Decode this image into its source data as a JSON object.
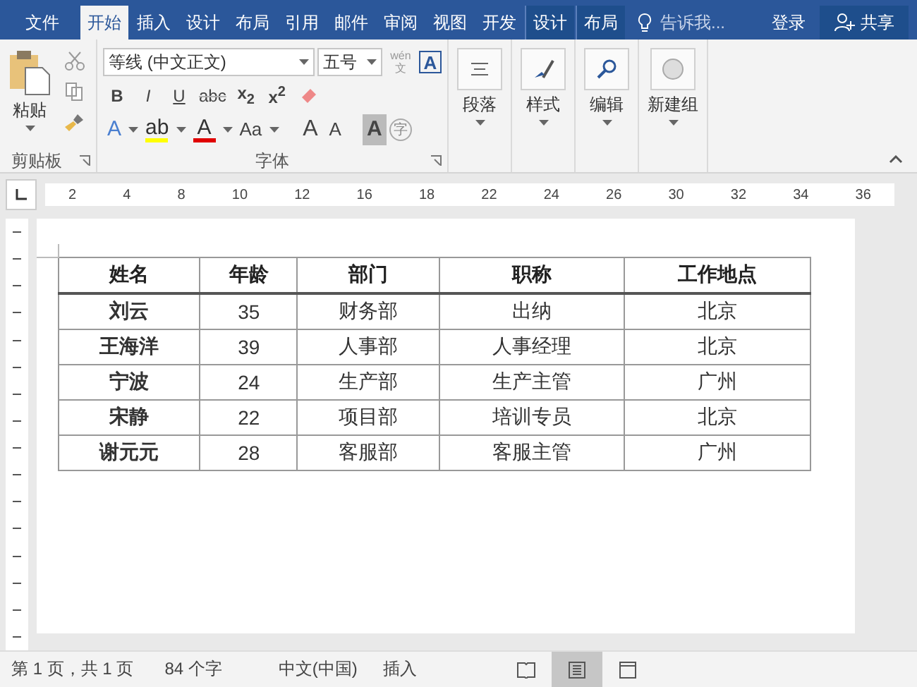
{
  "tabs": [
    {
      "label": "文件",
      "selected": false,
      "kind": "file"
    },
    {
      "label": "开始",
      "selected": true,
      "kind": "normal"
    },
    {
      "label": "插入",
      "selected": false,
      "kind": "normal"
    },
    {
      "label": "设计",
      "selected": false,
      "kind": "normal"
    },
    {
      "label": "布局",
      "selected": false,
      "kind": "normal"
    },
    {
      "label": "引用",
      "selected": false,
      "kind": "normal"
    },
    {
      "label": "邮件",
      "selected": false,
      "kind": "normal"
    },
    {
      "label": "审阅",
      "selected": false,
      "kind": "normal"
    },
    {
      "label": "视图",
      "selected": false,
      "kind": "normal"
    },
    {
      "label": "开发",
      "selected": false,
      "kind": "normal"
    },
    {
      "label": "设计",
      "selected": false,
      "kind": "contextual"
    },
    {
      "label": "布局",
      "selected": false,
      "kind": "contextual"
    }
  ],
  "tell_me": {
    "placeholder": "告诉我..."
  },
  "sign_in": "登录",
  "share": "共享",
  "ribbon": {
    "clipboard": {
      "paste": "粘贴",
      "label": "剪贴板"
    },
    "font": {
      "name": "等线 (中文正文)",
      "size": "五号",
      "phonetic": "wén",
      "phonetic_char": "文",
      "label": "字体",
      "format_buttons": [
        {
          "label": "B",
          "kind": "bold"
        },
        {
          "label": "I",
          "kind": "italic"
        },
        {
          "label": "U",
          "kind": "underline"
        },
        {
          "label": "abc",
          "kind": "strike"
        },
        {
          "label": "x$_{2}$",
          "kind": "script"
        },
        {
          "label": "x$^{2}$",
          "kind": "script"
        }
      ],
      "color_buttons": [
        {
          "label": "A",
          "kind": "effect",
          "color": "#4a7fd0"
        },
        {
          "label": "ab",
          "kind": "highlight",
          "color": "#ffff00"
        },
        {
          "label": "A",
          "kind": "fontcolor",
          "color": "#e00000"
        },
        {
          "label": "Aa",
          "kind": "case",
          "color": "#444444"
        }
      ],
      "size_buttons": [
        "A",
        "A"
      ],
      "border_char": "A",
      "shade": "A",
      "enclose": "字"
    },
    "large_buttons": [
      {
        "label": "段落",
        "kind": "paragraph"
      },
      {
        "label": "样式",
        "kind": "styles"
      },
      {
        "label": "编辑",
        "kind": "edit"
      },
      {
        "label": "新建组",
        "kind": "newgroup"
      }
    ]
  },
  "ruler": {
    "marks": [
      "2",
      "4",
      "8",
      "10",
      "12",
      "16",
      "18",
      "22",
      "24",
      "26",
      "30",
      "32",
      "34",
      "36"
    ]
  },
  "table": {
    "columns": [
      "姓名",
      "年龄",
      "部门",
      "职称",
      "工作地点"
    ],
    "rows": [
      [
        "刘云",
        "35",
        "财务部",
        "出纳",
        "北京"
      ],
      [
        "王海洋",
        "39",
        "人事部",
        "人事经理",
        "北京"
      ],
      [
        "宁波",
        "24",
        "生产部",
        "生产主管",
        "广州"
      ],
      [
        "宋静",
        "22",
        "项目部",
        "培训专员",
        "北京"
      ],
      [
        "谢元元",
        "28",
        "客服部",
        "客服主管",
        "广州"
      ]
    ]
  },
  "status_bar": {
    "page": "第 1 页，共 1 页",
    "words": "84 个字",
    "language": "中文(中国)",
    "mode": "插入",
    "views": [
      {
        "kind": "read",
        "selected": false
      },
      {
        "kind": "print",
        "selected": true
      },
      {
        "kind": "web",
        "selected": false
      }
    ]
  }
}
